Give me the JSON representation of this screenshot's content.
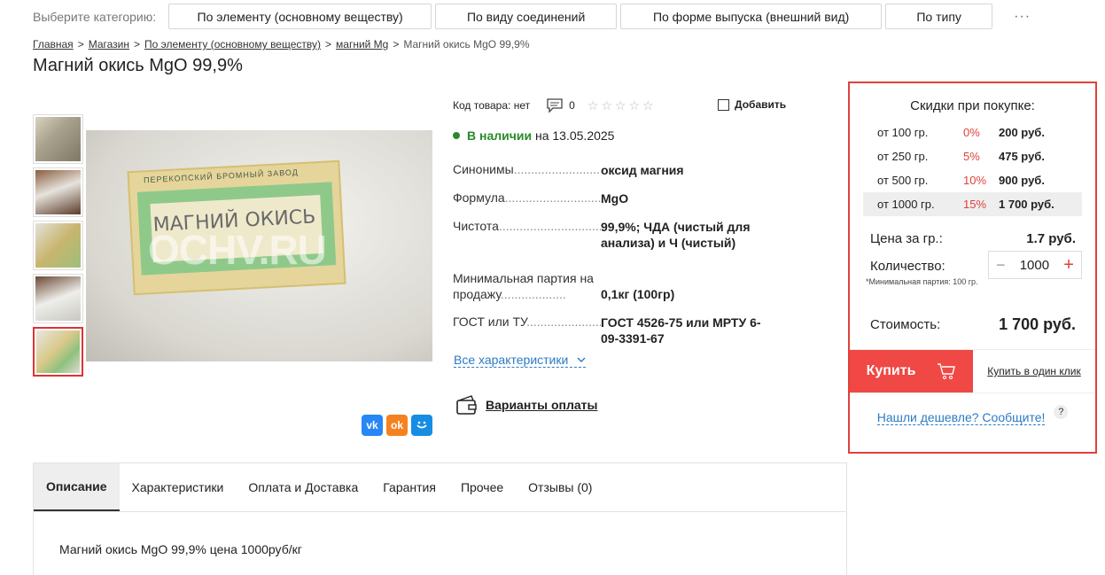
{
  "category_bar": {
    "label": "Выберите категорию:",
    "buttons": [
      "По элементу (основному веществу)",
      "По виду соединений",
      "По форме выпуска (внешний вид)",
      "По типу"
    ],
    "more": "···"
  },
  "breadcrumb": {
    "items": [
      "Главная",
      "Магазин",
      "По элементу (основному веществу)",
      "магний Mg"
    ],
    "separator": ">",
    "current": "Магний окись MgO 99,9%"
  },
  "title": "Магний окись MgO 99,9%",
  "image": {
    "label_factory": "ПЕРЕКОПСКИЙ БРОМНЫЙ ЗАВОД",
    "label_name": "МАГНИЙ ОКИСЬ",
    "watermark": "OCHV.RU"
  },
  "info": {
    "code_label": "Код товара: нет",
    "comments_count": "0",
    "stars": "☆☆☆☆☆",
    "compare_label": "Добавить",
    "stock_status": "В наличии",
    "stock_date": "на 13.05.2025",
    "props": [
      {
        "name": "Синонимы",
        "value": "оксид магния"
      },
      {
        "name": "Формула",
        "value": "MgO"
      },
      {
        "name": "Чистота",
        "value": "99,9%; ЧДА (чистый для анализа) и Ч (чистый)"
      },
      {
        "name": "Минимальная партия на продажу",
        "value": "0,1кг (100гр)"
      },
      {
        "name": "ГОСТ или ТУ",
        "value": "ГОСТ 4526-75 или МРТУ 6-09-3391-67"
      }
    ],
    "all_chars": "Все характеристики",
    "payment": "Варианты оплаты"
  },
  "tabs": {
    "items": [
      "Описание",
      "Характеристики",
      "Оплата и Доставка",
      "Гарантия",
      "Прочее",
      "Отзывы (0)"
    ],
    "description": "Магний окись MgO 99,9% цена 1000руб/кг"
  },
  "panel": {
    "title": "Скидки при покупке:",
    "discounts": [
      {
        "from": "от 100 гр.",
        "pct": "0%",
        "price": "200 руб."
      },
      {
        "from": "от 250 гр.",
        "pct": "5%",
        "price": "475 руб."
      },
      {
        "from": "от 500 гр.",
        "pct": "10%",
        "price": "900 руб."
      },
      {
        "from": "от 1000 гр.",
        "pct": "15%",
        "price": "1 700 руб."
      }
    ],
    "price_label": "Цена за гр.:",
    "price_value": "1.7 руб.",
    "qty_label": "Количество:",
    "qty_note": "*Минимальная партия: 100 гр.",
    "qty_value": "1000",
    "cost_label": "Стоимость:",
    "cost_value": "1 700 руб.",
    "buy_label": "Купить",
    "one_click": "Купить в один клик",
    "cheaper": "Нашли дешевле? Сообщите!",
    "help": "?"
  },
  "colors": {
    "accent": "#e0413b",
    "instock": "#2a8a2a",
    "link": "#2b7bc4"
  }
}
